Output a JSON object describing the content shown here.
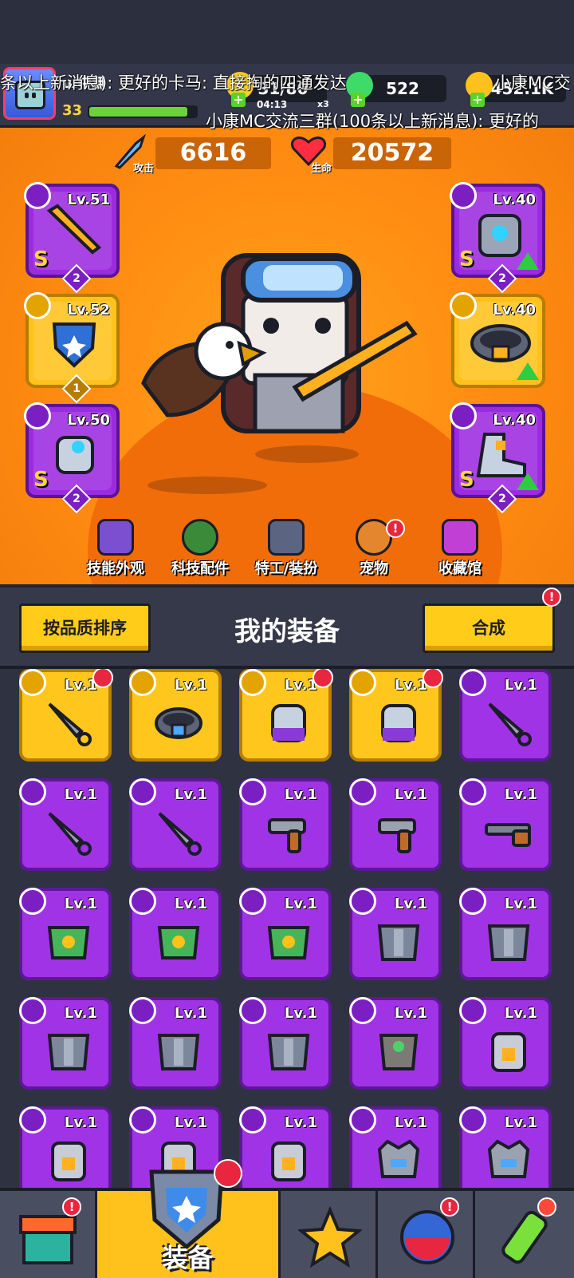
{
  "status_bar": {},
  "hud": {
    "player_name": "ш中無",
    "player_level": "33",
    "xp_fraction": 0.92,
    "energy": "31/80",
    "energy_timer": "04:13",
    "energy_multiplier": "x3",
    "gems": "522",
    "gold": "452.1K",
    "plus": "+"
  },
  "marquee": {
    "line1": "条以上新消息): 更好的卡马: 直接掏的四通发达",
    "line2": "小康MC交流三群(100条以上新消息): 更好的",
    "line3": "小康MC交"
  },
  "stats": {
    "attack_value": "6616",
    "attack_label": "攻击",
    "hp_value": "20572",
    "hp_label": "生命"
  },
  "equipped": {
    "weapon": {
      "level": "Lv.51",
      "grade": "S",
      "stars": "2"
    },
    "necklace": {
      "level": "Lv.52",
      "stars": "1"
    },
    "glove": {
      "level": "Lv.50",
      "grade": "S",
      "stars": "2"
    },
    "armor": {
      "level": "Lv.40",
      "grade": "S",
      "stars": "2"
    },
    "belt": {
      "level": "Lv.40"
    },
    "boots": {
      "level": "Lv.40",
      "grade": "S",
      "stars": "2"
    }
  },
  "menu": {
    "skill_skin": "技能外观",
    "tech_parts": "科技配件",
    "agent_outfit": "特工/装扮",
    "pet": "宠物",
    "collection": "收藏馆",
    "badge": "!"
  },
  "equipment_panel": {
    "sort_button": "按品质排序",
    "title": "我的装备",
    "merge_button": "合成",
    "badge": "!"
  },
  "grid_items": [
    {
      "level": "Lv.1",
      "quality": "gold",
      "kind": "kunai",
      "new": true
    },
    {
      "level": "Lv.1",
      "quality": "gold",
      "kind": "belt",
      "new": false
    },
    {
      "level": "Lv.1",
      "quality": "gold",
      "kind": "glove",
      "new": true
    },
    {
      "level": "Lv.1",
      "quality": "gold",
      "kind": "glove",
      "new": true
    },
    {
      "level": "Lv.1",
      "quality": "purple",
      "kind": "kunai",
      "new": false
    },
    {
      "level": "Lv.1",
      "quality": "purple",
      "kind": "kunai",
      "new": false
    },
    {
      "level": "Lv.1",
      "quality": "purple",
      "kind": "kunai",
      "new": false
    },
    {
      "level": "Lv.1",
      "quality": "purple",
      "kind": "revolver",
      "new": false
    },
    {
      "level": "Lv.1",
      "quality": "purple",
      "kind": "revolver",
      "new": false
    },
    {
      "level": "Lv.1",
      "quality": "purple",
      "kind": "shotgun",
      "new": false
    },
    {
      "level": "Lv.1",
      "quality": "purple",
      "kind": "green-armor",
      "new": false
    },
    {
      "level": "Lv.1",
      "quality": "purple",
      "kind": "green-armor",
      "new": false
    },
    {
      "level": "Lv.1",
      "quality": "purple",
      "kind": "green-armor",
      "new": false
    },
    {
      "level": "Lv.1",
      "quality": "purple",
      "kind": "steel-armor",
      "new": false
    },
    {
      "level": "Lv.1",
      "quality": "purple",
      "kind": "steel-armor",
      "new": false
    },
    {
      "level": "Lv.1",
      "quality": "purple",
      "kind": "steel-armor",
      "new": false
    },
    {
      "level": "Lv.1",
      "quality": "purple",
      "kind": "steel-armor",
      "new": false
    },
    {
      "level": "Lv.1",
      "quality": "purple",
      "kind": "steel-armor",
      "new": false
    },
    {
      "level": "Lv.1",
      "quality": "purple",
      "kind": "stone-armor",
      "new": false
    },
    {
      "level": "Lv.1",
      "quality": "purple",
      "kind": "robot-armor",
      "new": false
    },
    {
      "level": "Lv.1",
      "quality": "purple",
      "kind": "robot-armor",
      "new": false
    },
    {
      "level": "Lv.1",
      "quality": "purple",
      "kind": "robot-armor",
      "new": false
    },
    {
      "level": "Lv.1",
      "quality": "purple",
      "kind": "robot-armor",
      "new": false
    },
    {
      "level": "Lv.1",
      "quality": "purple",
      "kind": "crown-armor",
      "new": false
    },
    {
      "level": "Lv.1",
      "quality": "purple",
      "kind": "crown-armor",
      "new": false
    }
  ],
  "bottom_nav": {
    "equipment_label": "装备",
    "badge": "!"
  },
  "colors": {
    "gold_card": "#ffc71d",
    "purple_card": "#a133e6",
    "stage_orange": "#ff8c12",
    "button_yellow": "#ffcc1a"
  }
}
